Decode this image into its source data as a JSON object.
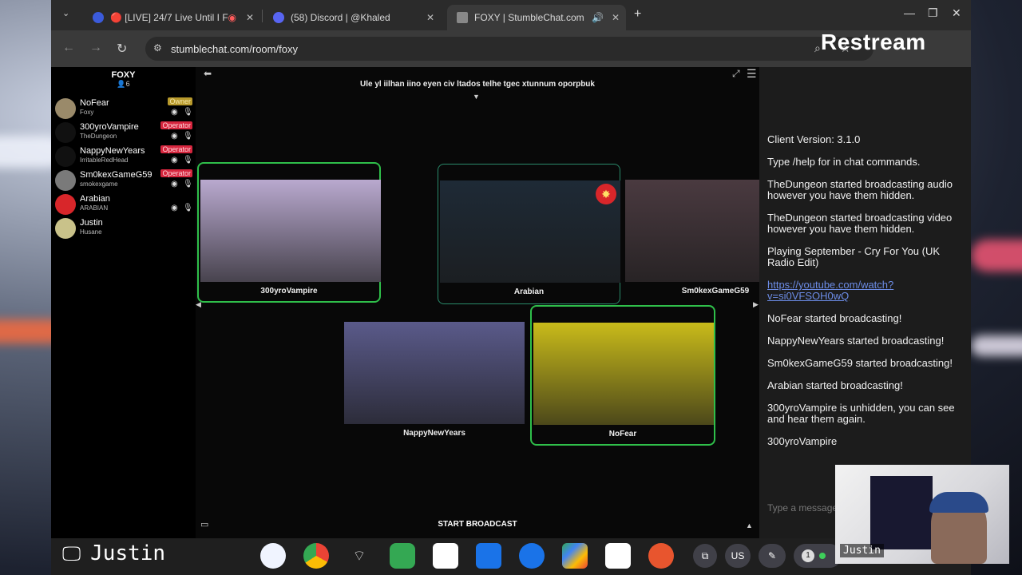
{
  "browser": {
    "tabs": [
      {
        "title": "🔴 [LIVE] 24/7 Live Until I F",
        "active": false
      },
      {
        "title": "(58) Discord | @Khaled",
        "active": false
      },
      {
        "title": "FOXY | StumbleChat.com",
        "active": true
      }
    ],
    "url": "stumblechat.com/room/foxy"
  },
  "overlay": {
    "brand": "Restream"
  },
  "room": {
    "title": "FOXY",
    "count": "6",
    "topic": "Ule yl iilhan iino eyen civ ltados telhe tgec xtunnum oporpbuk",
    "start_broadcast": "START BROADCAST"
  },
  "users": [
    {
      "name": "NoFear",
      "sub": "Foxy",
      "badge": "Owner",
      "avatar_color": "#9a8a6a"
    },
    {
      "name": "300yroVampire",
      "sub": "TheDungeon",
      "badge": "Operator",
      "avatar_color": "#111111"
    },
    {
      "name": "NappyNewYears",
      "sub": "IrritableRedHead",
      "badge": "Operator",
      "avatar_color": "#111111"
    },
    {
      "name": "Sm0kexGameG59",
      "sub": "smokexgame",
      "badge": "Operator",
      "avatar_color": "#7a7a7a"
    },
    {
      "name": "Arabian",
      "sub": "ARABIAN",
      "badge": "",
      "avatar_color": "#d8262a"
    },
    {
      "name": "Justin",
      "sub": "Husane",
      "badge": "",
      "avatar_color": "#c9c28a"
    }
  ],
  "cams": [
    {
      "name": "300yroVampire",
      "border": "green",
      "color": "#b9a9cf"
    },
    {
      "name": "Arabian",
      "border": "teal",
      "color": "#1e2a36"
    },
    {
      "name": "Sm0kexGameG59",
      "border": "none",
      "color": "#4a3a40"
    },
    {
      "name": "NappyNewYears",
      "border": "none",
      "color": "#5a5a8a"
    },
    {
      "name": "NoFear",
      "border": "green",
      "color": "#c9bb1a"
    }
  ],
  "chat": {
    "messages": [
      {
        "text": "Client Version: 3.1.0",
        "link": false
      },
      {
        "text": "Type /help for in chat commands.",
        "link": false
      },
      {
        "text": "TheDungeon started broadcasting audio however you have them hidden.",
        "link": false
      },
      {
        "text": "TheDungeon started broadcasting video however you have them hidden.",
        "link": false
      },
      {
        "text": "Playing September - Cry For You (UK Radio Edit)",
        "link": false
      },
      {
        "text": "https://youtube.com/watch?v=si0VFSOH0wQ",
        "link": true
      },
      {
        "text": "NoFear started broadcasting!",
        "link": false
      },
      {
        "text": "NappyNewYears started broadcasting!",
        "link": false
      },
      {
        "text": "Sm0kexGameG59 started broadcasting!",
        "link": false
      },
      {
        "text": "Arabian started broadcasting!",
        "link": false
      },
      {
        "text": "300yroVampire is unhidden, you can see and hear them again.",
        "link": false
      },
      {
        "text": "300yroVampire",
        "link": false
      }
    ],
    "input_placeholder": "Type a message"
  },
  "shelf": {
    "user": "Justin",
    "ime": "US",
    "notif_count": "1"
  },
  "webcam": {
    "name": "Justin"
  }
}
